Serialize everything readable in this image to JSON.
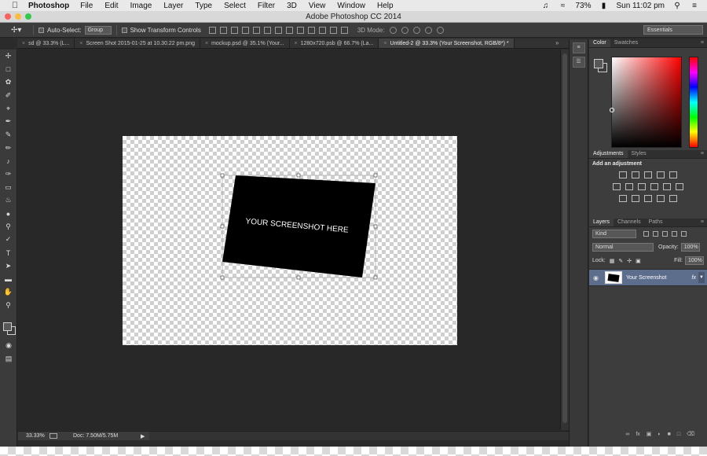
{
  "menubar": {
    "app_name": "Photoshop",
    "menus": [
      "File",
      "Edit",
      "Image",
      "Layer",
      "Type",
      "Select",
      "Filter",
      "3D",
      "View",
      "Window",
      "Help"
    ],
    "battery": "73%",
    "clock": "Sun 11:02 pm",
    "icons": [
      "apple-icon",
      "bell-icon",
      "wifi-icon",
      "battery-icon",
      "search-icon",
      "list-icon"
    ]
  },
  "window": {
    "title": "Adobe Photoshop CC 2014"
  },
  "options_bar": {
    "auto_select_label": "Auto-Select:",
    "auto_select_value": "Group",
    "transform_label": "Show Transform Controls",
    "mode_3d_label": "3D Mode:",
    "workspace": "Essentials"
  },
  "tabs": [
    {
      "label": "sd @ 33.3% (L...",
      "active": false
    },
    {
      "label": "Screen Shot 2015-01-25 at 10.30.22 pm.png",
      "active": false
    },
    {
      "label": "mockup.psd @ 35.1% (Your...",
      "active": false
    },
    {
      "label": "1280x720.psb @ 66.7% (La...",
      "active": false
    },
    {
      "label": "Untitled-2 @ 33.3% (Your Screenshot, RGB/8*) *",
      "active": true
    }
  ],
  "canvas": {
    "placeholder_text": "YOUR SCREENSHOT HERE"
  },
  "statusbar": {
    "zoom": "33.33%",
    "doc_info": "Doc: 7.50M/5.75M"
  },
  "panels": {
    "color_tabs": [
      "Color",
      "Swatches"
    ],
    "adjust_tabs": [
      "Adjustments",
      "Styles"
    ],
    "add_adjustment": "Add an adjustment",
    "layers_tabs": [
      "Layers",
      "Channels",
      "Paths"
    ],
    "kind_filter": "Kind",
    "blend_mode": "Normal",
    "opacity_label": "Opacity:",
    "opacity_value": "100%",
    "lock_label": "Lock:",
    "fill_label": "Fill:",
    "fill_value": "100%",
    "layer_name": "Your Screenshot",
    "fx_label": "fx"
  },
  "colors": {
    "app_bg": "#2b2b2b",
    "panel_bg": "#3d3d3d",
    "selected_layer": "#5c6e8c"
  }
}
